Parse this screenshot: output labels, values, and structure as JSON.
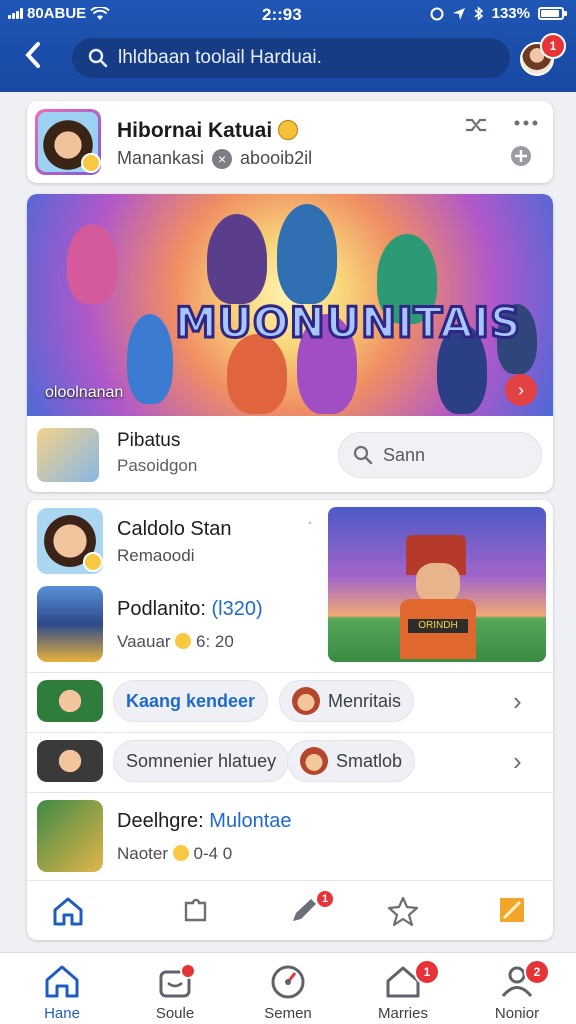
{
  "status_bar": {
    "carrier": "80ABUE",
    "time": "2::93",
    "battery": "133%"
  },
  "header": {
    "search_placeholder": "lhldbaan toolail Harduai.",
    "notif_count": "1"
  },
  "profile_card": {
    "name": "Hibornai Katuai",
    "subtitle": "Manankasi",
    "handle": "abooib2il"
  },
  "hero": {
    "title": "MUONUNITAIS",
    "caption": "oloolnanan",
    "row_title": "Pibatus",
    "row_subtitle": "Pasoidgon",
    "search_label": "Sann"
  },
  "list": {
    "item1_title": "Caldolo Stan",
    "item1_sub": "Remaoodi",
    "item2_title": "Podlanito: ",
    "item2_title_blue": "(l320)",
    "item2_sub": "Vaauar",
    "item2_meta": "6: 20",
    "chip1": "Kaang kendeer",
    "chip2": "Menritais",
    "chip3": "Somnenier hlatuey",
    "chip4": "Smatlob",
    "item3_title": "Deelhgre: ",
    "item3_title_blue": "Mulontae",
    "item3_sub": "Naoter",
    "item3_meta": "0-4 0",
    "tab_badge": "1",
    "feature_banner": "ORINDH"
  },
  "bottom_nav": [
    {
      "label": "Hane",
      "active": true,
      "badge": ""
    },
    {
      "label": "Soule",
      "active": false,
      "badge": ""
    },
    {
      "label": "Semen",
      "active": false,
      "badge": ""
    },
    {
      "label": "Marries",
      "active": false,
      "badge": "1"
    },
    {
      "label": "Nonior",
      "active": false,
      "badge": "2"
    }
  ],
  "colors": {
    "header_blue": "#1f56b5",
    "accent_red": "#e53337",
    "link_blue": "#1f6ad0"
  }
}
